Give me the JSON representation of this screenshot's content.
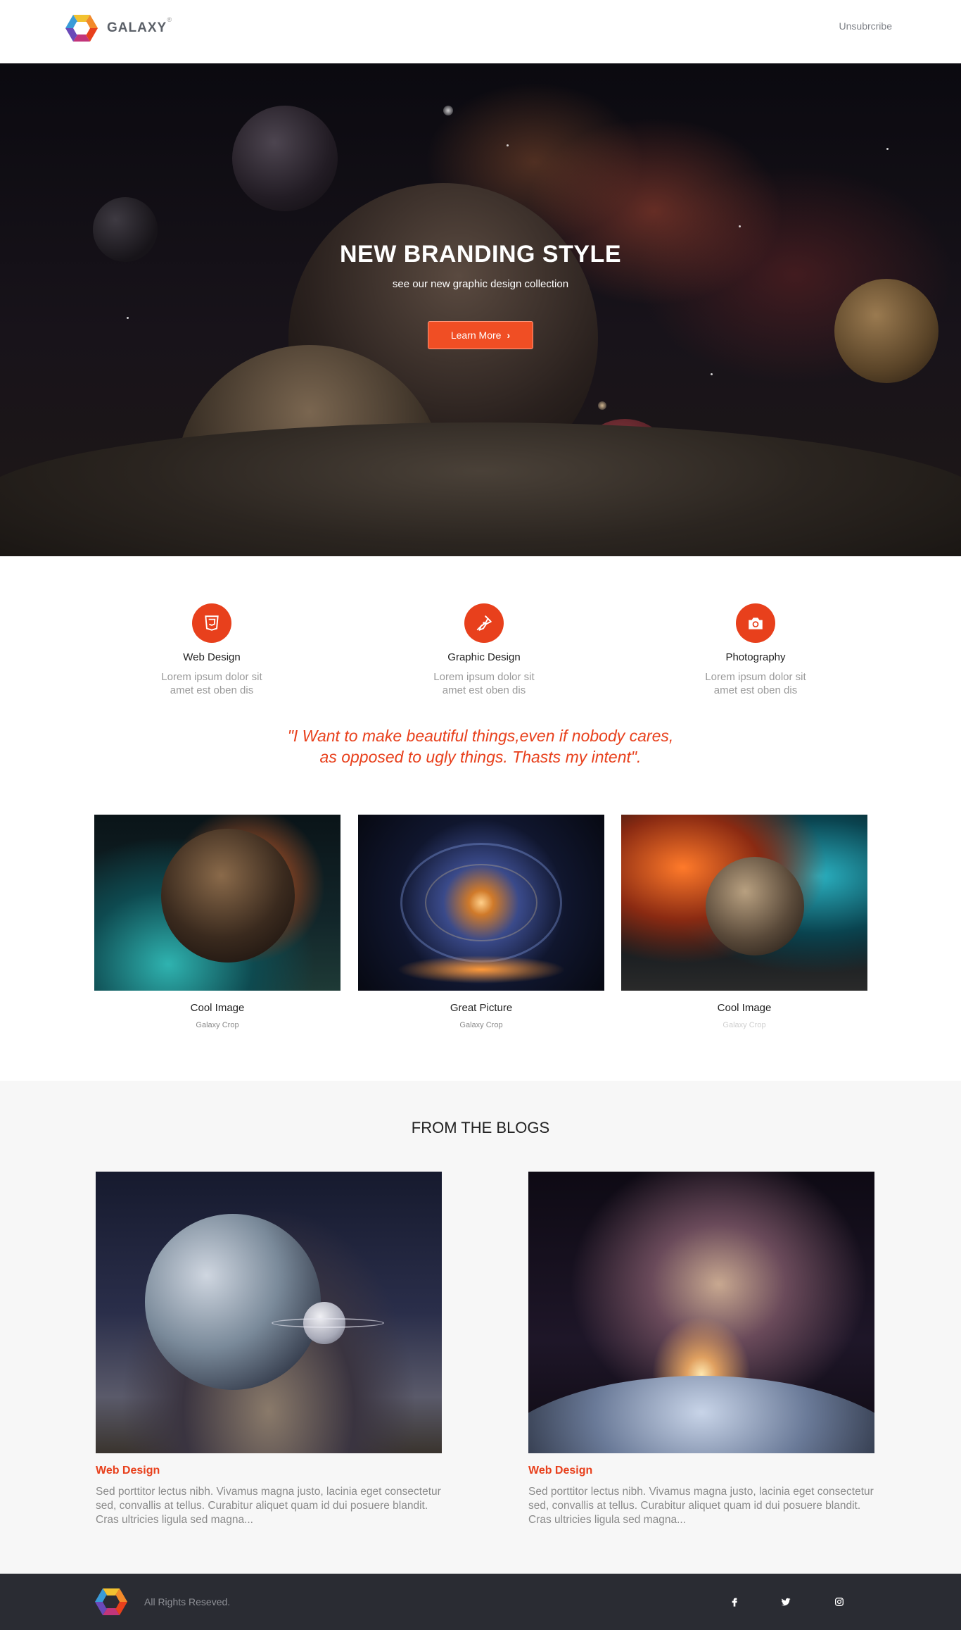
{
  "header": {
    "brand": "GALAXY",
    "brand_mark": "®",
    "unsubscribe": "Unsubrcribe"
  },
  "hero": {
    "title": "NEW BRANDING STYLE",
    "subtitle": "see our new graphic design collection",
    "button_label": "Learn More",
    "button_icon": "chevron-right-icon"
  },
  "services": [
    {
      "icon": "html5-icon",
      "title": "Web Design",
      "desc": "Lorem ipsum dolor sit amet est oben dis"
    },
    {
      "icon": "pen-nib-icon",
      "title": "Graphic Design",
      "desc": "Lorem ipsum dolor sit amet est oben dis"
    },
    {
      "icon": "camera-icon",
      "title": "Photography",
      "desc": "Lorem ipsum dolor sit amet est oben dis"
    }
  ],
  "quote": {
    "line1": "\"I Want to make beautiful things,even if nobody cares,",
    "line2": "as opposed to ugly things. Thasts my intent\"."
  },
  "gallery": [
    {
      "title": "Cool Image",
      "subtitle": "Galaxy Crop"
    },
    {
      "title": "Great Picture",
      "subtitle": "Galaxy Crop"
    },
    {
      "title": "Cool Image",
      "subtitle": "Galaxy Crop"
    }
  ],
  "blogs": {
    "heading": "FROM THE BLOGS",
    "posts": [
      {
        "category": "Web Design",
        "text": "Sed porttitor lectus nibh. Vivamus magna justo, lacinia eget consectetur sed, convallis at tellus. Curabitur aliquet quam id dui posuere blandit. Cras ultricies ligula sed magna..."
      },
      {
        "category": "Web Design",
        "text": "Sed porttitor lectus nibh. Vivamus magna justo, lacinia eget consectetur sed, convallis at tellus. Curabitur aliquet quam id dui posuere blandit. Cras ultricies ligula sed magna..."
      }
    ]
  },
  "footer": {
    "rights": "All Rights Reseved.",
    "social": [
      "facebook-icon",
      "twitter-icon",
      "instagram-icon"
    ]
  },
  "colors": {
    "accent": "#e8401c",
    "button": "#f04e24",
    "footer_bg": "#2a2c33",
    "blogs_bg": "#f7f7f7"
  }
}
